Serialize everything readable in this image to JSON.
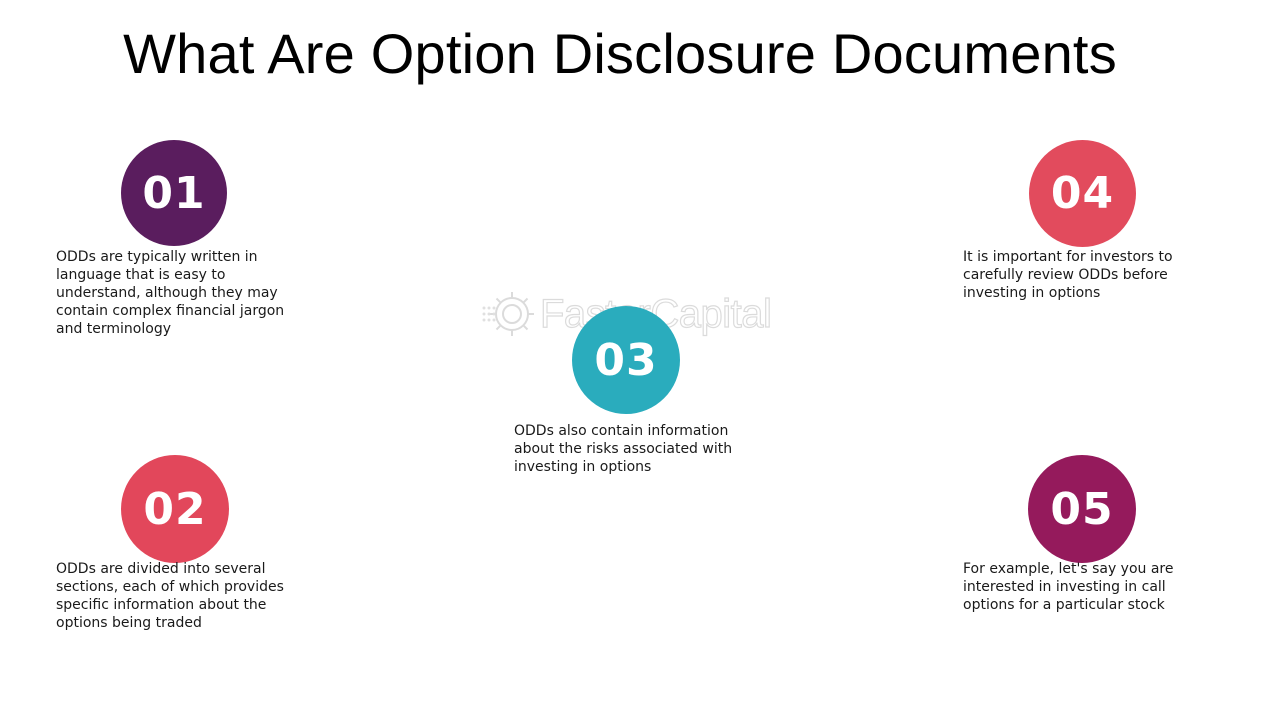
{
  "title": "What Are Option Disclosure Documents",
  "watermark": "FasterCapital",
  "steps": [
    {
      "number": "01",
      "color": "#5a1d5e",
      "text": "ODDs are typically written in language that is easy to understand, although they may contain complex financial jargon and terminology"
    },
    {
      "number": "02",
      "color": "#e2475b",
      "text": "ODDs are divided into several sections, each of which provides specific information about the options being traded"
    },
    {
      "number": "03",
      "color": "#2aacbd",
      "text": "ODDs also contain information about the risks associated with investing in options"
    },
    {
      "number": "04",
      "color": "#e24b5d",
      "text": "It is important for investors to carefully review ODDs before investing in options"
    },
    {
      "number": "05",
      "color": "#951a5c",
      "text": "For example, let's say you are interested in investing in call options for a particular stock"
    }
  ]
}
